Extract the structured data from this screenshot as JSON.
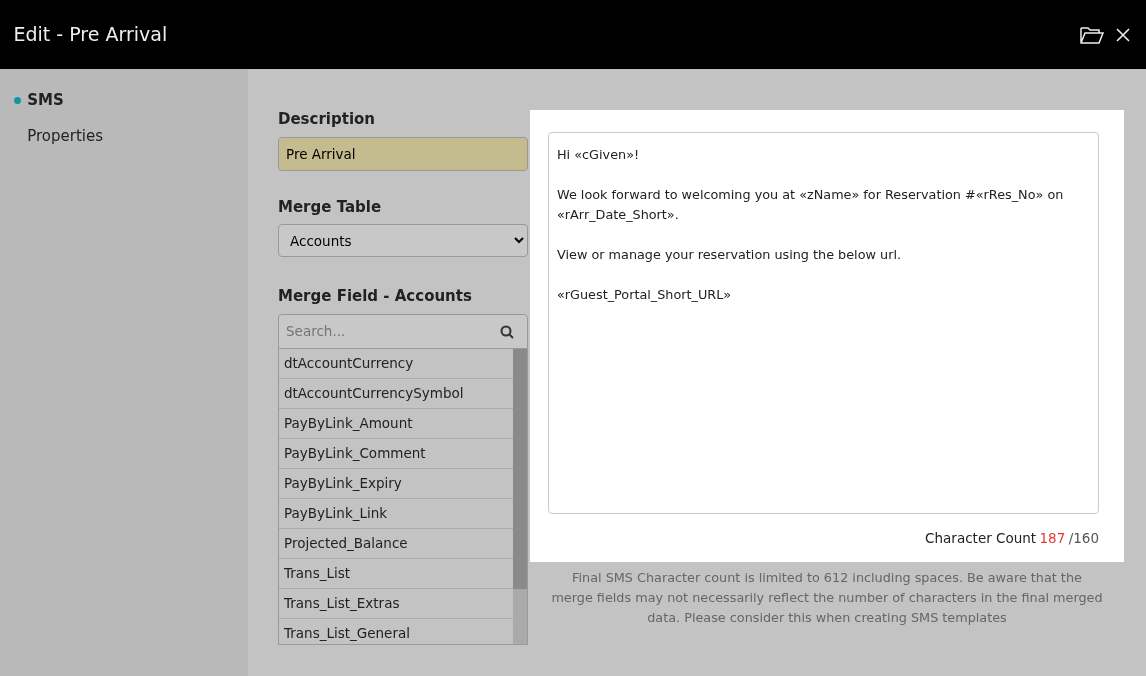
{
  "window": {
    "title": "Edit - Pre Arrival"
  },
  "sidebar": {
    "items": [
      {
        "label": "SMS",
        "selected": true
      },
      {
        "label": "Properties",
        "selected": false
      }
    ]
  },
  "description": {
    "label": "Description",
    "value": "Pre Arrival"
  },
  "merge_table": {
    "label": "Merge Table",
    "value": "Accounts"
  },
  "merge_field": {
    "label": "Merge Field - Accounts",
    "search_placeholder": "Search...",
    "items": [
      "dtAccountCurrency",
      "dtAccountCurrencySymbol",
      "PayByLink_Amount",
      "PayByLink_Comment",
      "PayByLink_Expiry",
      "PayByLink_Link",
      "Projected_Balance",
      "Trans_List",
      "Trans_List_Extras",
      "Trans_List_General"
    ]
  },
  "message": {
    "paragraphs": [
      "Hi «cGiven»!",
      "We look forward to welcoming you at «zName» for Reservation #«rRes_No» on «rArr_Date_Short».",
      "View or manage your reservation using the below url.",
      "«rGuest_Portal_Short_URL»"
    ]
  },
  "character_count": {
    "label": "Character Count",
    "count": "187",
    "limit": "/160",
    "over_limit": true
  },
  "note": "Final SMS Character count is limited to 612 including spaces. Be aware that the merge fields may not necessarily reflect the number of characters in the final merged data. Please consider this when creating SMS templates"
}
